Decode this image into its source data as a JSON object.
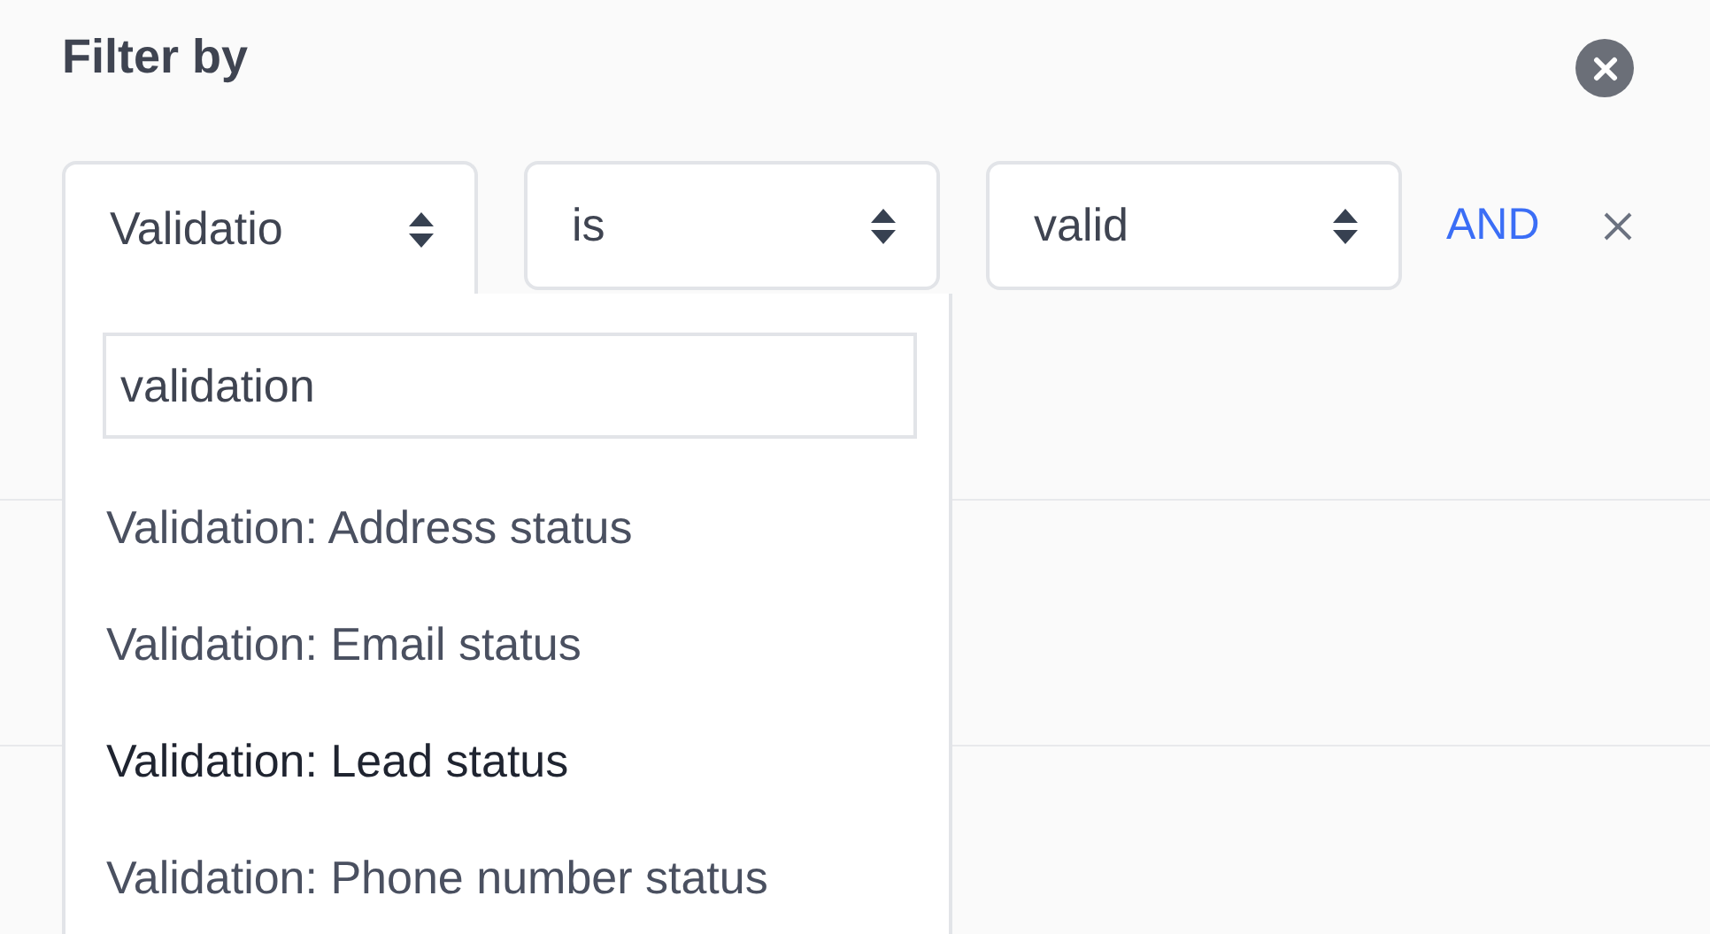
{
  "title": "Filter by",
  "filters": [
    {
      "value": "Validatio",
      "open": true
    },
    {
      "value": "is",
      "open": false
    },
    {
      "value": "valid",
      "open": false
    }
  ],
  "conjunction": "AND",
  "search": {
    "value": "validation"
  },
  "options": [
    {
      "label": "Validation: Address status",
      "highlighted": false
    },
    {
      "label": "Validation: Email status",
      "highlighted": false
    },
    {
      "label": "Validation: Lead status",
      "highlighted": true
    },
    {
      "label": "Validation: Phone number status",
      "highlighted": false
    }
  ]
}
